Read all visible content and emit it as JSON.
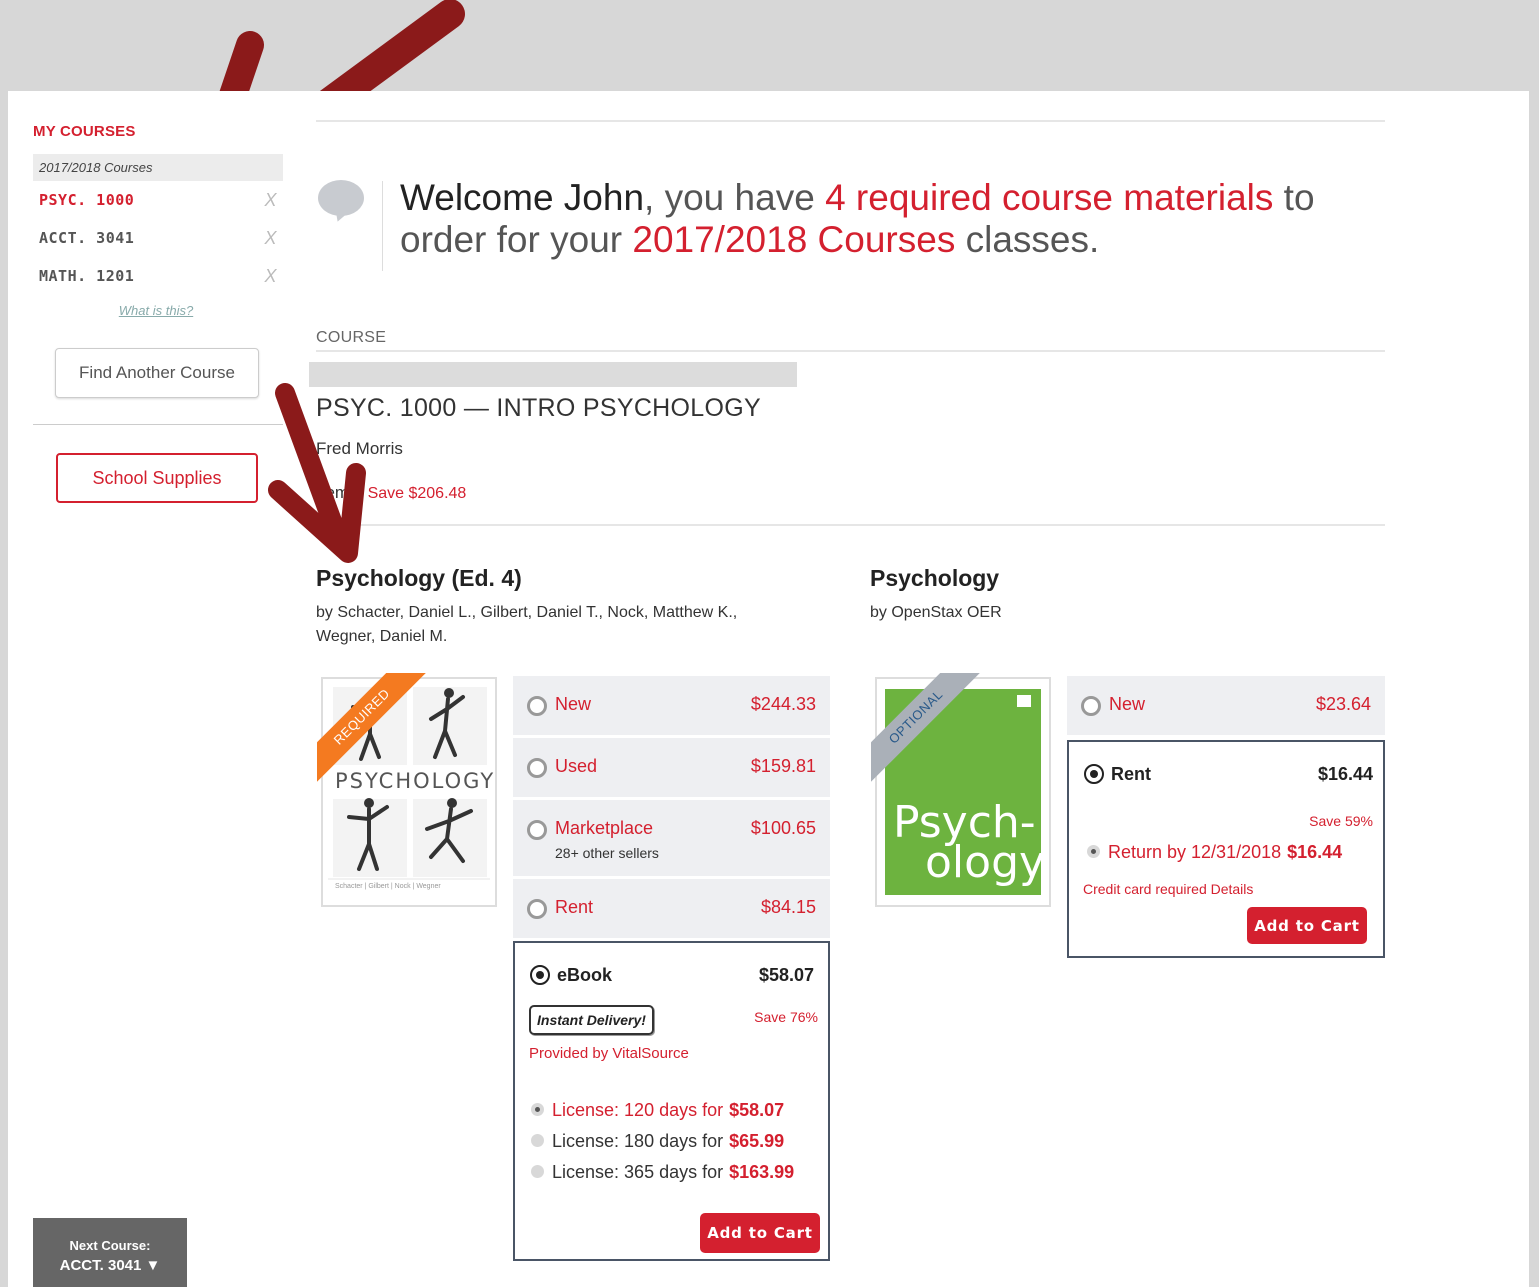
{
  "sidebar": {
    "heading": "MY COURSES",
    "term": "2017/2018 Courses",
    "courses": [
      {
        "code": "PSYC. 1000",
        "remove": "X"
      },
      {
        "code": "ACCT. 3041",
        "remove": "X"
      },
      {
        "code": "MATH. 1201",
        "remove": "X"
      }
    ],
    "what_link": "What is this?",
    "find_button": "Find Another Course",
    "supplies_button": "School Supplies",
    "next_label": "Next Course:",
    "next_course": "ACCT. 3041 ▼"
  },
  "welcome": {
    "name": "Welcome John",
    "t1": ", you have ",
    "count": "4 required course materials",
    "t2": " to order for your ",
    "term": "2017/2018 Courses",
    "t3": " classes."
  },
  "course": {
    "section_label": "COURSE",
    "title": "PSYC. 1000 — INTRO PSYCHOLOGY",
    "instructor": "Fred Morris",
    "items_label": "Items",
    "save_label": "Save $206.48"
  },
  "books": [
    {
      "title": "Psychology (Ed. 4)",
      "authors_l1": "by Schacter, Daniel L., Gilbert, Daniel T., Nock, Matthew K.,",
      "authors_l2": "Wegner, Daniel M.",
      "ribbon": "REQUIRED",
      "cover_word": "PSYCHOLOGY",
      "cover_authors": "Schacter | Gilbert | Nock | Wegner",
      "options": [
        {
          "label": "New",
          "price": "$244.33"
        },
        {
          "label": "Used",
          "price": "$159.81"
        },
        {
          "label": "Marketplace",
          "price": "$100.65",
          "sub": "28+ other sellers"
        },
        {
          "label": "Rent",
          "price": "$84.15"
        }
      ],
      "selected": {
        "label": "eBook",
        "price": "$58.07",
        "badge": "Instant Delivery!",
        "save": "Save 76%",
        "provider": "Provided by VitalSource",
        "licenses": [
          {
            "text": "License: 120 days for",
            "price": "$58.07"
          },
          {
            "text": "License: 180 days for",
            "price": "$65.99"
          },
          {
            "text": "License: 365 days for",
            "price": "$163.99"
          }
        ],
        "add": "Add to Cart"
      }
    },
    {
      "title": "Psychology",
      "authors_l1": "by OpenStax OER",
      "ribbon": "OPTIONAL",
      "cover_word_1": "Psych-",
      "cover_word_2": "ology",
      "options": [
        {
          "label": "New",
          "price": "$23.64"
        }
      ],
      "selected": {
        "label": "Rent",
        "price": "$16.44",
        "save": "Save 59%",
        "return_text": "Return by 12/31/2018",
        "return_price": "$16.44",
        "credit": "Credit card required Details",
        "add": "Add to Cart"
      }
    }
  ],
  "colors": {
    "accent": "#d4202f",
    "arrow": "#8b1a1a",
    "ribbon_required": "#f47a20",
    "ribbon_optional": "#aab0b8",
    "cover_green": "#6db33f"
  }
}
